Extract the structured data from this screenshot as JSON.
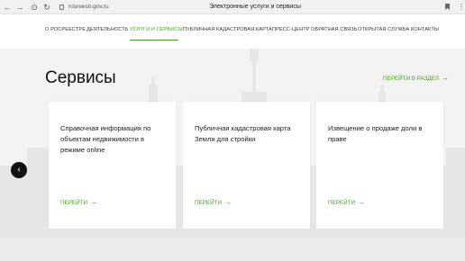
{
  "browser": {
    "url": "rosreestr.gov.ru",
    "tab_title": "Электронные услуги и сервисы",
    "back_glyph": "←",
    "forward_glyph": "→",
    "shield_glyph": "⊙",
    "reload_glyph": "↻",
    "menu_glyph": "⋮"
  },
  "nav": {
    "items": [
      {
        "label": "О РОСРЕЕСТРЕ"
      },
      {
        "label": "ДЕЯТЕЛЬНОСТЬ"
      },
      {
        "label": "УСЛУГИ И СЕРВИСЫ",
        "active": true
      },
      {
        "label": "ПУБЛИЧНАЯ КАДАСТРОВАЯ КАРТА"
      },
      {
        "label": "ПРЕСС-ЦЕНТР"
      },
      {
        "label": "ОБРАТНАЯ СВЯЗЬ"
      },
      {
        "label": "ОТКРЫТАЯ СЛУЖБА"
      },
      {
        "label": "КОНТАКТЫ"
      }
    ]
  },
  "section": {
    "title": "Сервисы",
    "link_label": "ПЕРЕЙТИ В РАЗДЕЛ",
    "arrow": "→"
  },
  "cards": [
    {
      "text": "Справочная информация по объектам недвижимости в режиме online",
      "link_label": "ПЕРЕЙТИ",
      "arrow": "→"
    },
    {
      "text": "Публичная кадастровая карта Земля для стройки",
      "link_label": "ПЕРЕЙТИ",
      "arrow": "→"
    },
    {
      "text": "Извещение о продаже доли в праве",
      "link_label": "ПЕРЕЙТИ",
      "arrow": "→"
    }
  ],
  "carousel": {
    "prev_glyph": "‹"
  },
  "colors": {
    "accent": "#4a9a2c",
    "background": "#f3f3f3"
  }
}
